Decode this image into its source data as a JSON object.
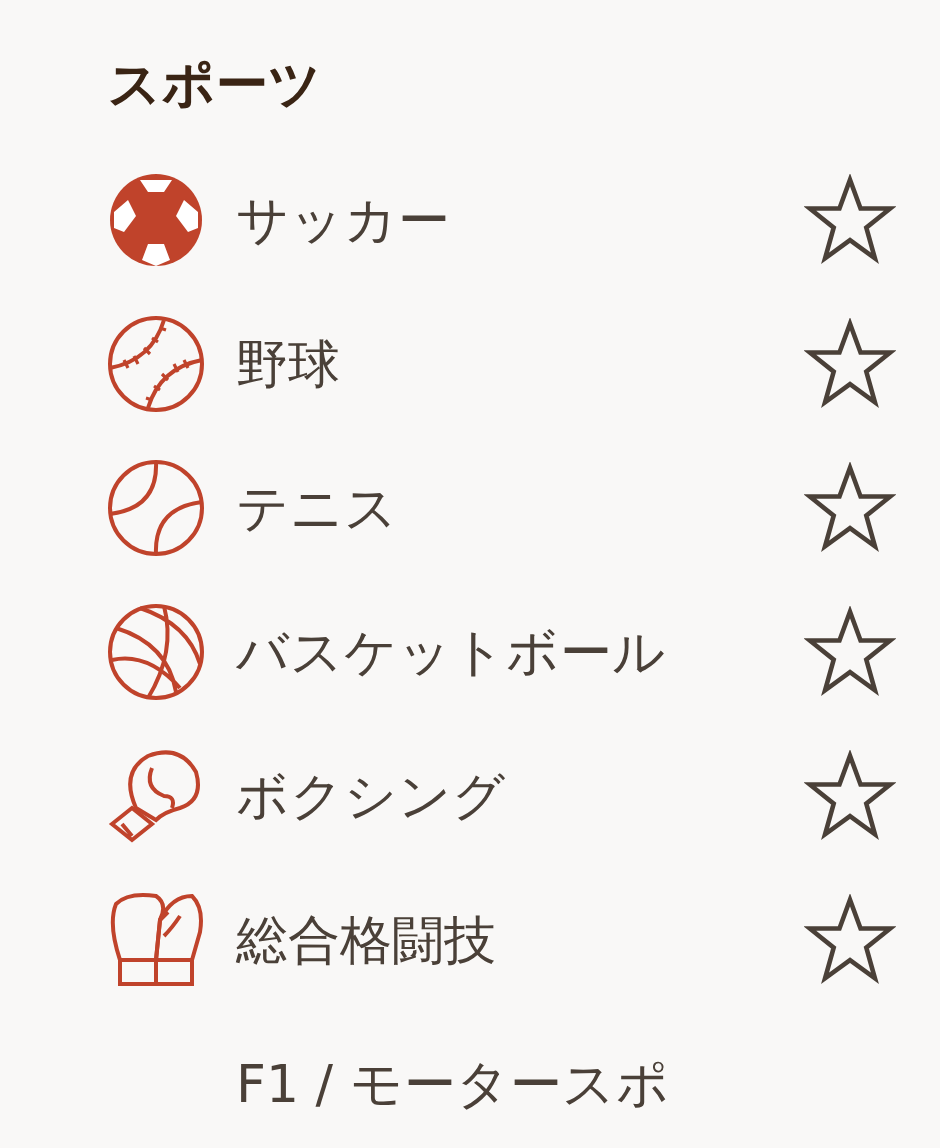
{
  "section": {
    "title": "スポーツ"
  },
  "items": [
    {
      "kind": "soccer",
      "label": "サッカー",
      "starred": false
    },
    {
      "kind": "baseball",
      "label": "野球",
      "starred": false
    },
    {
      "kind": "tennis",
      "label": "テニス",
      "starred": false
    },
    {
      "kind": "basketball",
      "label": "バスケットボール",
      "starred": false
    },
    {
      "kind": "boxing",
      "label": "ボクシング",
      "starred": false
    },
    {
      "kind": "mma",
      "label": "総合格闘技",
      "starred": false
    },
    {
      "kind": "none",
      "label": "F1 / モータースポ"
    }
  ]
}
